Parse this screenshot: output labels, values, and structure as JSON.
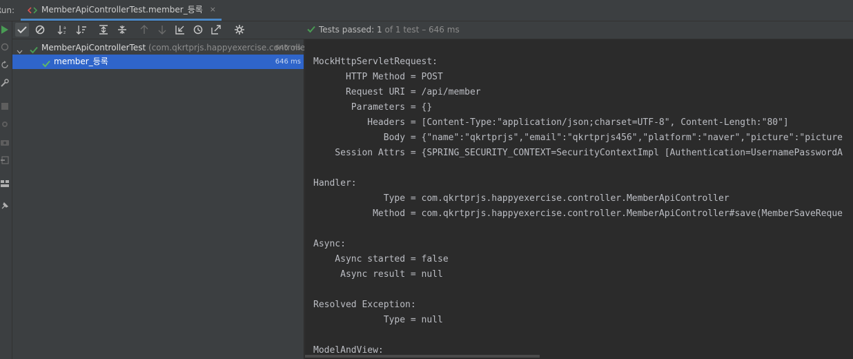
{
  "tab_bar": {
    "run_label": "Run:",
    "tab_title": "MemberApiControllerTest.member_등록",
    "close_glyph": "×"
  },
  "left_toolbar": [
    {
      "icon": "rerun-icon",
      "color": "#499c54"
    },
    {
      "icon": "debug-icon"
    },
    {
      "icon": "rerun-failed-icon"
    },
    {
      "icon": "wrench-icon"
    },
    {
      "icon": "stop-icon"
    },
    {
      "icon": "settings-icon"
    },
    {
      "icon": "camera-icon"
    },
    {
      "icon": "exit-icon"
    },
    {
      "icon": "layout-icon"
    },
    {
      "icon": "pin-icon"
    }
  ],
  "tree_toolbar": [
    {
      "name": "show-passed-toggle",
      "icon": "check-icon",
      "active": true
    },
    {
      "name": "show-ignored-toggle",
      "icon": "ignore-icon"
    },
    {
      "name": "sort-alpha-button",
      "icon": "sort-alpha-icon"
    },
    {
      "name": "sort-duration-button",
      "icon": "sort-duration-icon"
    },
    {
      "name": "expand-all-button",
      "icon": "expand-icon"
    },
    {
      "name": "collapse-all-button",
      "icon": "collapse-icon"
    },
    {
      "name": "prev-failed-button",
      "icon": "arrow-up-icon"
    },
    {
      "name": "next-failed-button",
      "icon": "arrow-down-icon"
    },
    {
      "name": "import-tests-button",
      "icon": "import-icon"
    },
    {
      "name": "test-history-button",
      "icon": "history-icon"
    },
    {
      "name": "export-results-button",
      "icon": "export-icon"
    },
    {
      "name": "test-settings-button",
      "icon": "gear-icon"
    }
  ],
  "status": {
    "passed_label": "Tests passed:",
    "passed_count": "1",
    "of_text": "of 1 test",
    "duration": "– 646 ms",
    "accent": "#499c54"
  },
  "tree": {
    "root": {
      "label": "MemberApiControllerTest",
      "package": "(com.qkrtprjs.happyexercise.controlle",
      "duration": "646 ms"
    },
    "child": {
      "label": "member_등록",
      "duration": "646 ms"
    },
    "selection_color": "#2f65ca"
  },
  "console_lines": [
    "MockHttpServletRequest:",
    "      HTTP Method = POST",
    "      Request URI = /api/member",
    "       Parameters = {}",
    "          Headers = [Content-Type:\"application/json;charset=UTF-8\", Content-Length:\"80\"]",
    "             Body = {\"name\":\"qkrtprjs\",\"email\":\"qkrtprjs456\",\"platform\":\"naver\",\"picture\":\"picture",
    "    Session Attrs = {SPRING_SECURITY_CONTEXT=SecurityContextImpl [Authentication=UsernamePasswordA",
    "",
    "Handler:",
    "             Type = com.qkrtprjs.happyexercise.controller.MemberApiController",
    "           Method = com.qkrtprjs.happyexercise.controller.MemberApiController#save(MemberSaveReque",
    "",
    "Async:",
    "    Async started = false",
    "     Async result = null",
    "",
    "Resolved Exception:",
    "             Type = null",
    "",
    "ModelAndView:"
  ]
}
